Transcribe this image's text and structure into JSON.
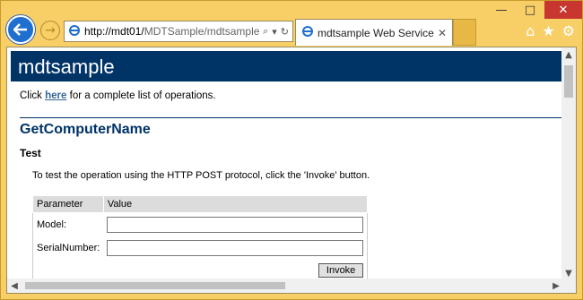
{
  "window": {
    "minimize_glyph": "—",
    "maximize_glyph": "□",
    "close_glyph": "✕"
  },
  "nav": {
    "back_glyph": "←",
    "forward_glyph": "→",
    "address_host": "http://mdt01/",
    "address_rest": "MDTSample/mdtsample",
    "search_glyph": "⌕",
    "dropdown_glyph": "▾",
    "refresh_glyph": "↻"
  },
  "tab": {
    "title": "mdtsample Web Service",
    "close_glyph": "✕"
  },
  "toolbar": {
    "home_glyph": "⌂",
    "favorites_glyph": "★",
    "settings_glyph": "⚙"
  },
  "page": {
    "banner": "mdtsample",
    "intro_prefix": "Click",
    "intro_link": "here",
    "intro_suffix": "for a complete list of operations.",
    "operation": "GetComputerName",
    "test_heading": "Test",
    "test_note": "To test the operation using the HTTP POST protocol, click the 'Invoke' button.",
    "table": {
      "col_param": "Parameter",
      "col_value": "Value",
      "rows": [
        {
          "label": "Model:",
          "value": ""
        },
        {
          "label": "SerialNumber:",
          "value": ""
        }
      ],
      "invoke": "Invoke"
    }
  },
  "scroll": {
    "up": "▲",
    "down": "▼",
    "left": "◀",
    "right": "▶"
  },
  "colors": {
    "banner": "#003366",
    "frame": "#f6c24a",
    "link": "#336699",
    "back_button": "#1e6fd0",
    "close_button": "#c7372f"
  }
}
